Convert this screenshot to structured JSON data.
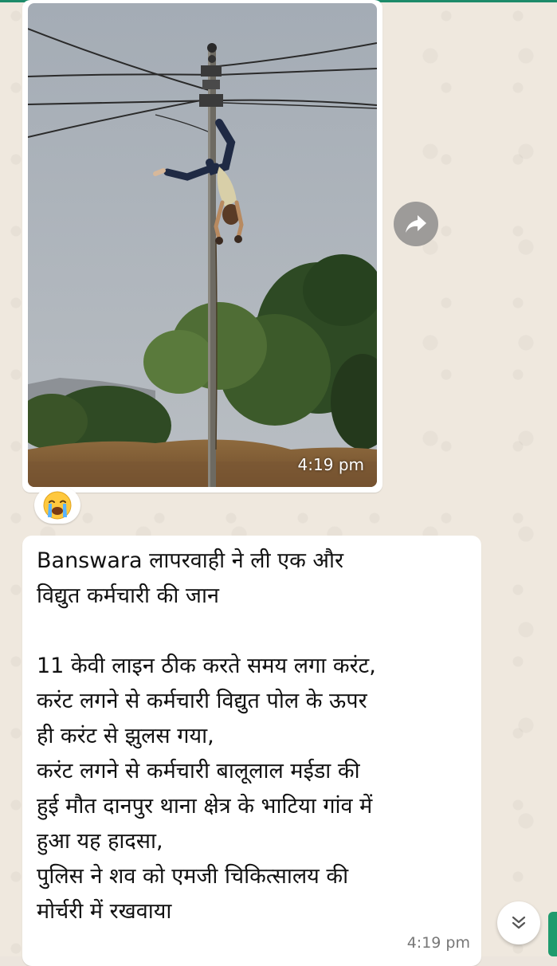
{
  "image_message": {
    "time": "4:19 pm",
    "photo_icon": "photo-electric-pole",
    "forward_icon": "forward-arrow-icon"
  },
  "reaction": {
    "emoji": "😭",
    "icon": "loudly-crying-face-icon"
  },
  "text_message": {
    "lines": [
      "Banswara  लापरवाही ने ली एक और",
      "विद्युत कर्मचारी की जान",
      "",
      "11 केवी लाइन ठीक करते समय लगा करंट,",
      "करंट लगने से कर्मचारी विद्युत पोल के ऊपर",
      "ही करंट से झुलस गया,",
      "करंट लगने से कर्मचारी बालूलाल मईडा की",
      "हुई मौत दानपुर थाना क्षेत्र के भाटिया गांव में",
      "हुआ यह हादसा,",
      "पुलिस ने शव को एमजी चिकित्सालय की",
      "मोर्चरी में रखवाया"
    ],
    "time": "4:19 pm"
  },
  "scroll_button": {
    "icon": "double-chevron-down-icon"
  },
  "colors": {
    "accent": "#1d8b6a",
    "bubble": "#ffffff",
    "wallpaper": "#efe8de"
  }
}
